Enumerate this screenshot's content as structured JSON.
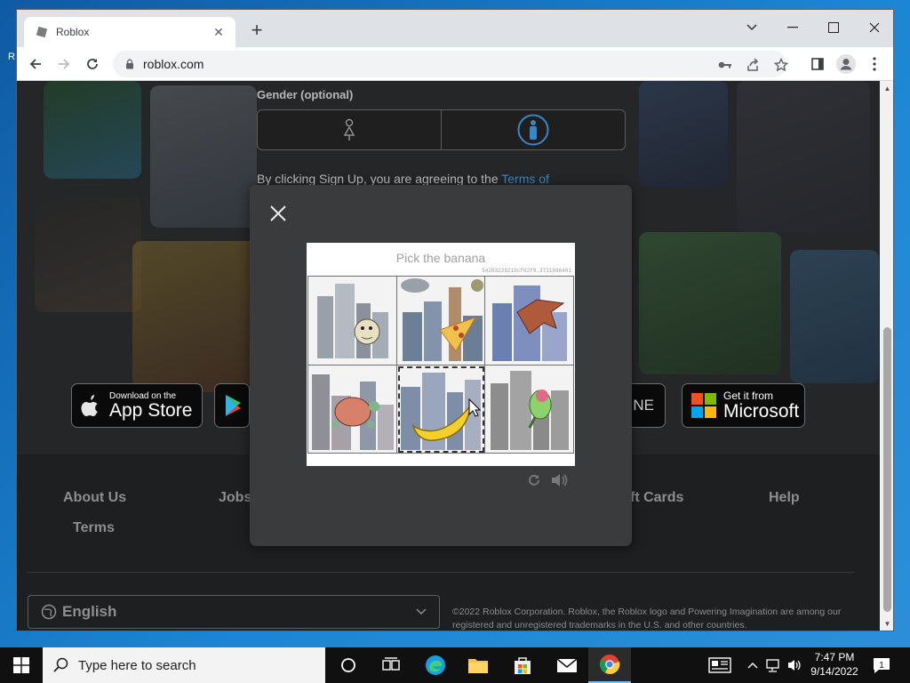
{
  "desktop": {
    "edge_label": "R"
  },
  "browser": {
    "tab_title": "Roblox",
    "url": "roblox.com"
  },
  "page": {
    "gender_label": "Gender (optional)",
    "terms_prefix": "By clicking Sign Up, you are agreeing to the",
    "terms_link": "Terms of",
    "app_store": {
      "small": "Download on the",
      "big": "App Store"
    },
    "xbox_partial": "NE",
    "microsoft": {
      "small": "Get it from",
      "big": "Microsoft"
    },
    "footer_links": [
      "About Us",
      "Jobs",
      "ft Cards",
      "Help",
      "Terms"
    ],
    "language": "English",
    "copyright": "©2022 Roblox Corporation. Roblox, the Roblox logo and Powering Imagination are among our registered and unregistered trademarks in the U.S. and other countries."
  },
  "captcha": {
    "prompt": "Pick the banana",
    "id_code": "54263229219cf62f9.3731096401",
    "tiles": [
      {
        "subject": "monkey",
        "selected": false
      },
      {
        "subject": "pizza",
        "selected": false
      },
      {
        "subject": "bird",
        "selected": false
      },
      {
        "subject": "turtle",
        "selected": false
      },
      {
        "subject": "banana",
        "selected": true
      },
      {
        "subject": "parrot",
        "selected": false
      }
    ]
  },
  "taskbar": {
    "search_placeholder": "Type here to search",
    "time": "7:47 PM",
    "date": "9/14/2022",
    "notification_count": "1"
  },
  "colors": {
    "link": "#3a86c8",
    "taskbar": "#101010",
    "modal": "#3a3b3c"
  }
}
